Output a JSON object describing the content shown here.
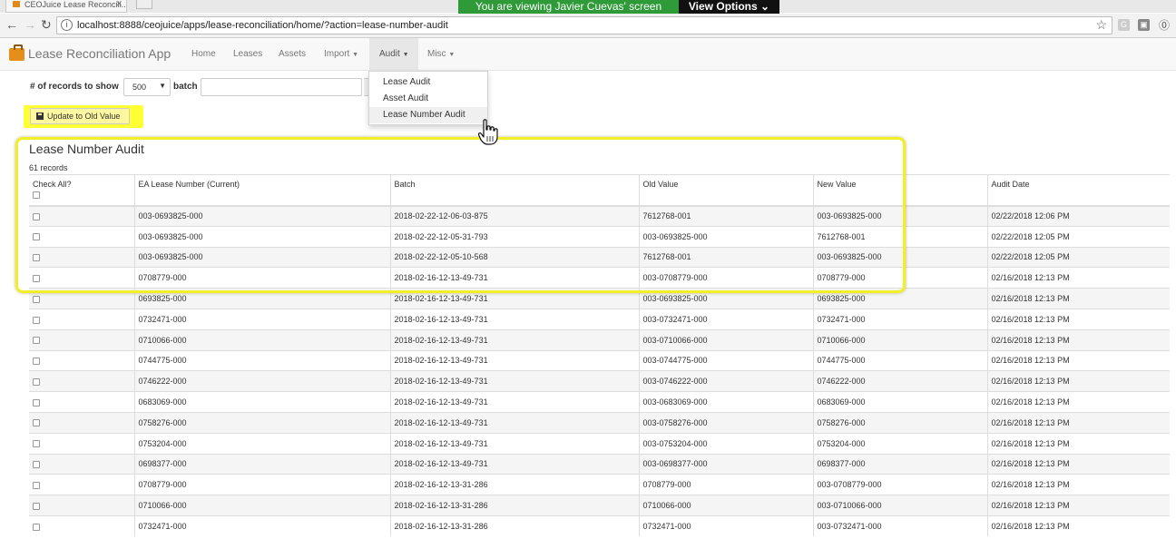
{
  "browser": {
    "tab_title": "CEOJuice Lease Reconcili...",
    "banner_text": "You are viewing Javier Cuevas' screen",
    "view_options_label": "View Options",
    "url": "localhost:8888/ceojuice/apps/lease-reconciliation/home/?action=lease-number-audit"
  },
  "navbar": {
    "brand": "Lease Reconciliation App",
    "items": [
      {
        "label": "Home"
      },
      {
        "label": "Leases"
      },
      {
        "label": "Assets"
      },
      {
        "label": "Import"
      },
      {
        "label": "Audit"
      },
      {
        "label": "Misc"
      }
    ]
  },
  "audit_menu": {
    "items": [
      {
        "label": "Lease Audit"
      },
      {
        "label": "Asset Audit"
      },
      {
        "label": "Lease Number Audit"
      }
    ]
  },
  "form": {
    "records_label": "# of records to show",
    "records_value": "500",
    "batch_label": "batch",
    "batch_value": "",
    "update_button_label": "Update to Old Value"
  },
  "page": {
    "title": "Lease Number Audit",
    "record_count": "61 records"
  },
  "table": {
    "columns": [
      "Check All?",
      "EA Lease Number (Current)",
      "Batch",
      "Old Value",
      "New Value",
      "Audit Date"
    ],
    "rows": [
      [
        "003-0693825-000",
        "2018-02-22-12-06-03-875",
        "7612768-001",
        "003-0693825-000",
        "02/22/2018 12:06 PM"
      ],
      [
        "003-0693825-000",
        "2018-02-22-12-05-31-793",
        "003-0693825-000",
        "7612768-001",
        "02/22/2018 12:05 PM"
      ],
      [
        "003-0693825-000",
        "2018-02-22-12-05-10-568",
        "7612768-001",
        "003-0693825-000",
        "02/22/2018 12:05 PM"
      ],
      [
        "0708779-000",
        "2018-02-16-12-13-49-731",
        "003-0708779-000",
        "0708779-000",
        "02/16/2018 12:13 PM"
      ],
      [
        "0693825-000",
        "2018-02-16-12-13-49-731",
        "003-0693825-000",
        "0693825-000",
        "02/16/2018 12:13 PM"
      ],
      [
        "0732471-000",
        "2018-02-16-12-13-49-731",
        "003-0732471-000",
        "0732471-000",
        "02/16/2018 12:13 PM"
      ],
      [
        "0710066-000",
        "2018-02-16-12-13-49-731",
        "003-0710066-000",
        "0710066-000",
        "02/16/2018 12:13 PM"
      ],
      [
        "0744775-000",
        "2018-02-16-12-13-49-731",
        "003-0744775-000",
        "0744775-000",
        "02/16/2018 12:13 PM"
      ],
      [
        "0746222-000",
        "2018-02-16-12-13-49-731",
        "003-0746222-000",
        "0746222-000",
        "02/16/2018 12:13 PM"
      ],
      [
        "0683069-000",
        "2018-02-16-12-13-49-731",
        "003-0683069-000",
        "0683069-000",
        "02/16/2018 12:13 PM"
      ],
      [
        "0758276-000",
        "2018-02-16-12-13-49-731",
        "003-0758276-000",
        "0758276-000",
        "02/16/2018 12:13 PM"
      ],
      [
        "0753204-000",
        "2018-02-16-12-13-49-731",
        "003-0753204-000",
        "0753204-000",
        "02/16/2018 12:13 PM"
      ],
      [
        "0698377-000",
        "2018-02-16-12-13-49-731",
        "003-0698377-000",
        "0698377-000",
        "02/16/2018 12:13 PM"
      ],
      [
        "0708779-000",
        "2018-02-16-12-13-31-286",
        "0708779-000",
        "003-0708779-000",
        "02/16/2018 12:13 PM"
      ],
      [
        "0710066-000",
        "2018-02-16-12-13-31-286",
        "0710066-000",
        "003-0710066-000",
        "02/16/2018 12:13 PM"
      ],
      [
        "0732471-000",
        "2018-02-16-12-13-31-286",
        "0732471-000",
        "003-0732471-000",
        "02/16/2018 12:13 PM"
      ]
    ]
  },
  "colors": {
    "highlight": "#f2ee27",
    "banner": "#2e9a38",
    "brand_icon": "#e58e1a"
  },
  "icons": [
    "back-arrow-icon",
    "forward-arrow-icon",
    "reload-icon",
    "info-icon",
    "star-icon",
    "briefcase-icon",
    "floppy-save-icon",
    "hand-pointer-cursor"
  ]
}
